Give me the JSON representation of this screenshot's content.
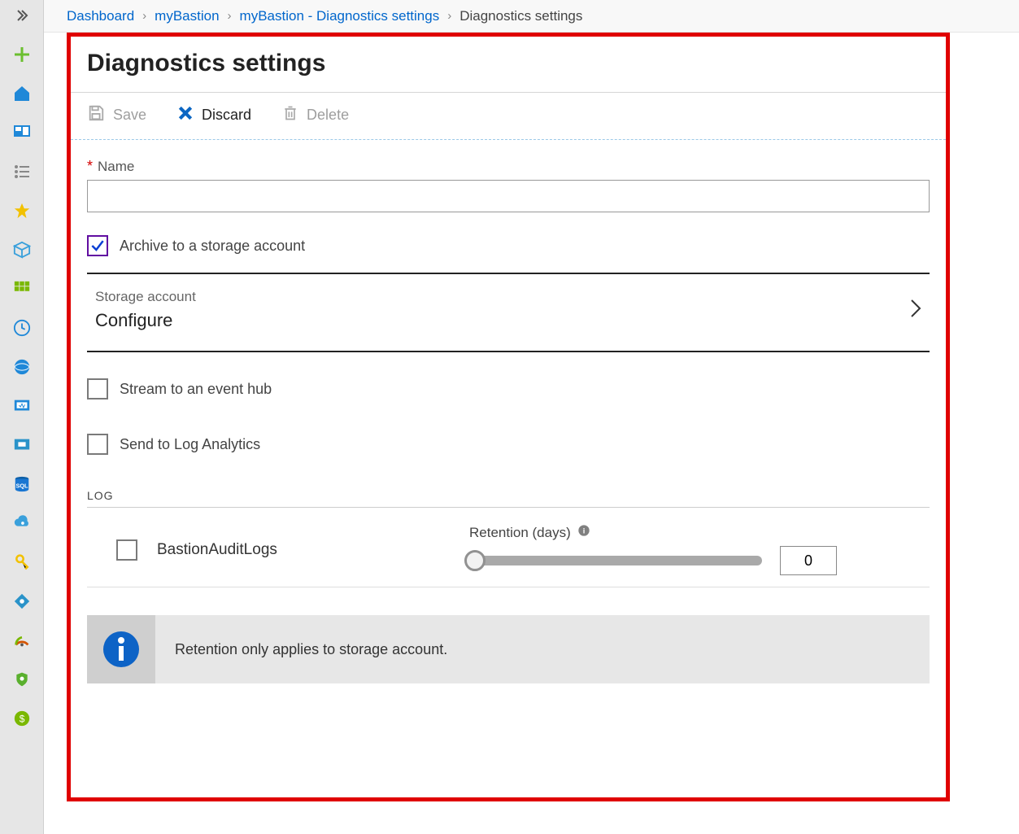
{
  "breadcrumb": {
    "items": [
      {
        "label": "Dashboard",
        "link": true
      },
      {
        "label": "myBastion",
        "link": true
      },
      {
        "label": "myBastion - Diagnostics settings",
        "link": true
      },
      {
        "label": "Diagnostics settings",
        "link": false
      }
    ]
  },
  "header": {
    "title": "Diagnostics settings"
  },
  "toolbar": {
    "save": {
      "label": "Save",
      "enabled": false
    },
    "discard": {
      "label": "Discard",
      "enabled": true
    },
    "delete": {
      "label": "Delete",
      "enabled": false
    }
  },
  "form": {
    "name_label": "Name",
    "name_value": "",
    "archive_label": "Archive to a storage account",
    "archive_checked": true,
    "storage": {
      "label": "Storage account",
      "value": "Configure"
    },
    "stream_label": "Stream to an event hub",
    "stream_checked": false,
    "log_analytics_label": "Send to Log Analytics",
    "log_analytics_checked": false
  },
  "log": {
    "section_header": "LOG",
    "retention_label": "Retention (days)",
    "items": [
      {
        "name": "BastionAuditLogs",
        "checked": false,
        "retention_days": "0"
      }
    ]
  },
  "info": {
    "message": "Retention only applies to storage account."
  },
  "sidebar": {
    "icons": [
      "expand-icon",
      "add-icon",
      "home-icon",
      "dashboard-icon",
      "list-icon",
      "favorite-icon",
      "cube-icon",
      "grid-icon",
      "clock-icon",
      "globe-icon",
      "monitor-icon",
      "monitor2-icon",
      "database-icon",
      "cloud-gear-icon",
      "key-icon",
      "network-icon",
      "gauge-icon",
      "shield-icon",
      "cost-icon"
    ]
  }
}
